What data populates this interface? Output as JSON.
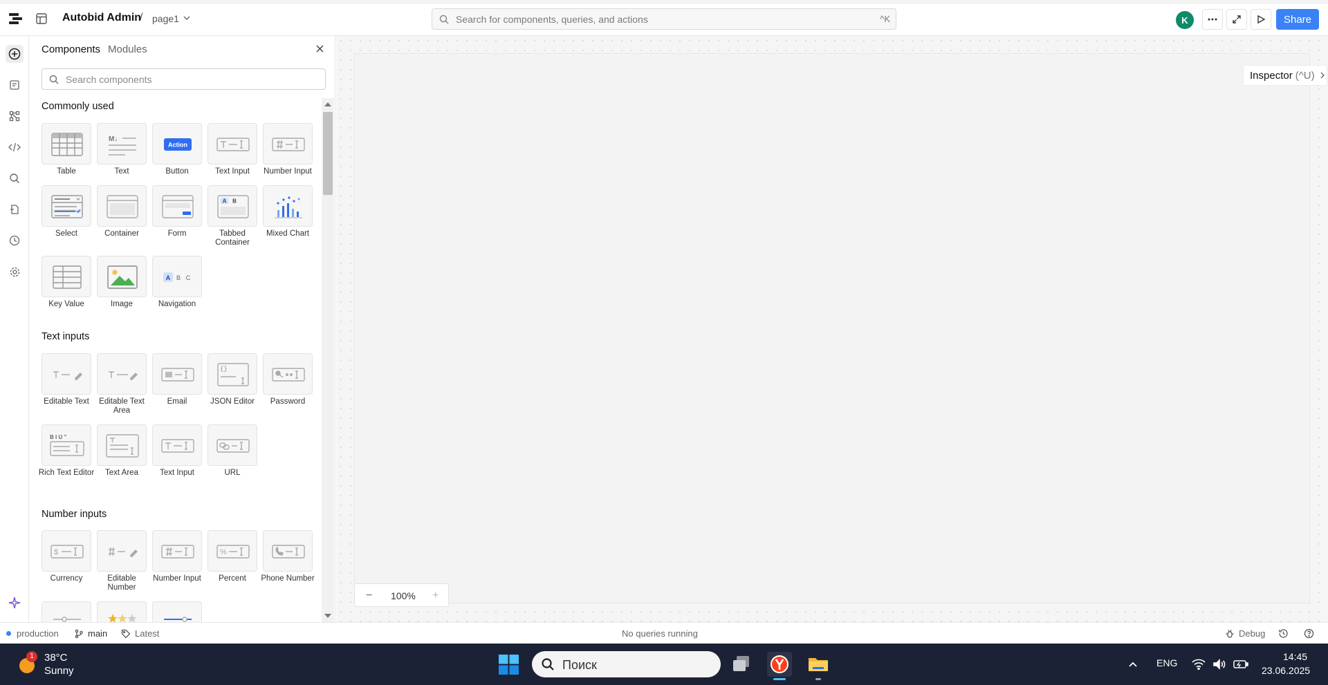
{
  "topbar": {
    "app_name": "Autobid Admin",
    "separator": "/",
    "page_name": "page1",
    "search_placeholder": "Search for components, queries, and actions",
    "search_shortcut": "^K",
    "avatar_initial": "K",
    "share_label": "Share"
  },
  "left_rail": {
    "items": [
      "add-component",
      "queries",
      "components-tree",
      "code",
      "search",
      "transform",
      "history",
      "settings",
      "assist"
    ]
  },
  "panel": {
    "tab_components": "Components",
    "tab_modules": "Modules",
    "search_placeholder": "Search components",
    "sections": [
      {
        "title": "Commonly used",
        "items": [
          "Table",
          "Text",
          "Button",
          "Text Input",
          "Number Input",
          "Select",
          "Container",
          "Form",
          "Tabbed Container",
          "Mixed Chart",
          "Key Value",
          "Image",
          "Navigation"
        ]
      },
      {
        "title": "Text inputs",
        "items": [
          "Editable Text",
          "Editable Text Area",
          "Email",
          "JSON Editor",
          "Password",
          "Rich Text Editor",
          "Text Area",
          "Text Input",
          "URL"
        ]
      },
      {
        "title": "Number inputs",
        "items": [
          "Currency",
          "Editable Number",
          "Number Input",
          "Percent",
          "Phone Number"
        ]
      }
    ],
    "button_tile_text": "Action",
    "markdown_tile_text": "M↓",
    "rich_text_tile_text": "B I U ”"
  },
  "canvas": {
    "inspector_label": "Inspector",
    "inspector_shortcut": "(^U)",
    "zoom_level": "100%"
  },
  "statusbar": {
    "environment": "production",
    "branch": "main",
    "version": "Latest",
    "queries_status": "No queries running",
    "debug_label": "Debug"
  },
  "taskbar": {
    "weather_badge": "1",
    "temperature": "38°C",
    "weather": "Sunny",
    "search_placeholder": "Поиск",
    "language": "ENG",
    "time": "14:45",
    "date": "23.06.2025"
  },
  "colors": {
    "accent": "#3b82f6",
    "avatar": "#0f8a6a",
    "taskbar": "#1c2235"
  }
}
